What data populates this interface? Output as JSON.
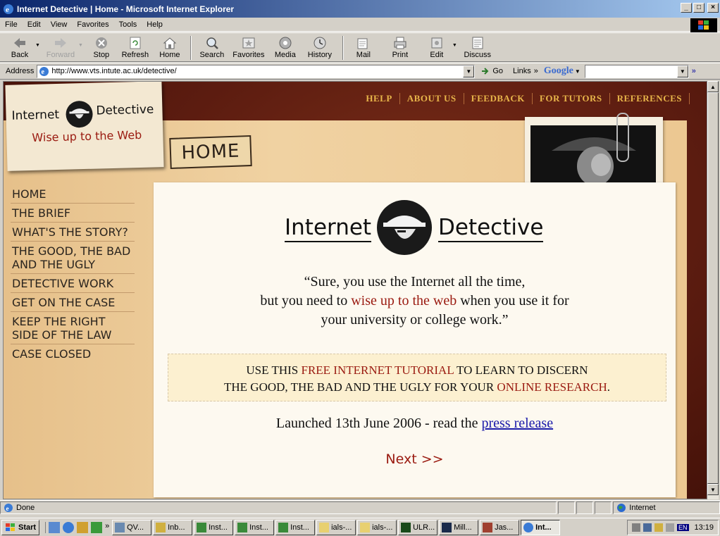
{
  "window": {
    "title": "Internet Detective | Home - Microsoft Internet Explorer",
    "controls": [
      "_",
      "□",
      "×"
    ]
  },
  "menu": [
    "File",
    "Edit",
    "View",
    "Favorites",
    "Tools",
    "Help"
  ],
  "toolbar": {
    "back": "Back",
    "forward": "Forward",
    "stop": "Stop",
    "refresh": "Refresh",
    "home": "Home",
    "search": "Search",
    "favorites": "Favorites",
    "media": "Media",
    "history": "History",
    "mail": "Mail",
    "print": "Print",
    "edit": "Edit",
    "discuss": "Discuss"
  },
  "address": {
    "label": "Address",
    "url": "http://www.vts.intute.ac.uk/detective/",
    "go": "Go",
    "links": "Links",
    "google": "Google"
  },
  "page": {
    "logo_word1": "Internet",
    "logo_word2": "Detective",
    "tagline": "Wise up to the Web",
    "section_tag": "HOME",
    "top_nav": [
      "HELP",
      "ABOUT US",
      "FEEDBACK",
      "FOR TUTORS",
      "REFERENCES"
    ],
    "left_nav": [
      "HOME",
      "THE BRIEF",
      "WHAT'S THE STORY?",
      "THE GOOD, THE BAD AND THE UGLY",
      "DETECTIVE WORK",
      "GET ON THE CASE",
      "KEEP THE RIGHT SIDE OF THE LAW",
      "CASE CLOSED"
    ],
    "quote": {
      "line1": "“Sure, you use the Internet all the time,",
      "line2_a": "but you need to ",
      "line2_red": "wise up to the web",
      "line2_b": " when you use it for",
      "line3": "your university or college work.”"
    },
    "banner": {
      "a": "USE THIS ",
      "red1": "FREE INTERNET TUTORIAL",
      "b": " TO LEARN TO DISCERN",
      "c": "THE GOOD, THE BAD AND THE UGLY FOR YOUR ",
      "red2": "ONLINE RESEARCH",
      "d": "."
    },
    "launch_text": "Launched 13th June 2006 - read the ",
    "launch_link": "press release",
    "next": "Next >>"
  },
  "status": {
    "left": "Done",
    "zone": "Internet"
  },
  "taskbar": {
    "start": "Start",
    "tasks": [
      "QV...",
      "Inb...",
      "Inst...",
      "Inst...",
      "Inst...",
      "ials-...",
      "ials-...",
      "ULR...",
      "Mill...",
      "Jas...",
      "Int..."
    ],
    "lang": "EN",
    "clock": "13:19"
  },
  "colors": {
    "accent_red": "#9a1a10",
    "nav_gold": "#e8b54a",
    "leather": "#5c1c10",
    "paper": "#f0d2a2"
  }
}
